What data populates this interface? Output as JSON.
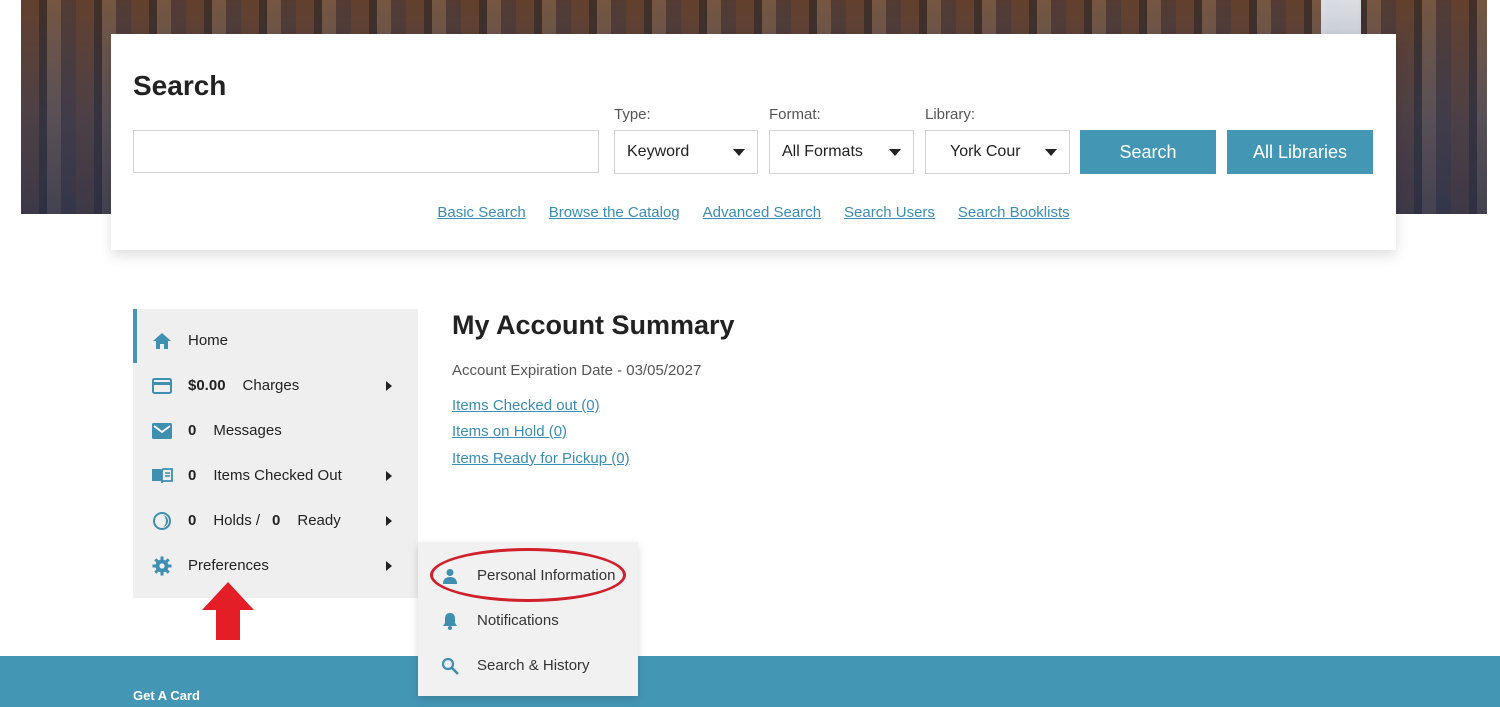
{
  "search": {
    "title": "Search",
    "query_value": "",
    "type_label": "Type:",
    "type_value": "Keyword",
    "format_label": "Format:",
    "format_value": "All Formats",
    "library_label": "Library:",
    "library_value": "York Cour",
    "search_button": "Search",
    "all_libraries_button": "All Libraries",
    "links": [
      "Basic Search",
      "Browse the Catalog",
      "Advanced Search",
      "Search Users",
      "Search Booklists"
    ]
  },
  "sidebar": {
    "home": "Home",
    "charges_amount": "$0.00",
    "charges_label": "Charges",
    "messages_count": "0",
    "messages_label": "Messages",
    "checked_out_count": "0",
    "checked_out_label": "Items Checked Out",
    "holds_count": "0",
    "holds_label": "Holds /",
    "ready_count": "0",
    "ready_label": "Ready",
    "preferences": "Preferences"
  },
  "main": {
    "title": "My Account Summary",
    "expiration": "Account Expiration Date - 03/05/2027",
    "links": [
      "Items Checked out (0)",
      "Items on Hold (0)",
      "Items Ready for Pickup (0)"
    ]
  },
  "submenu": {
    "items": [
      "Personal Information",
      "Notifications",
      "Search & History"
    ]
  },
  "footer": {
    "get_card": "Get A Card"
  },
  "colors": {
    "accent": "#4496b5",
    "link": "#3a8db3",
    "annotation": "#d0202b"
  }
}
